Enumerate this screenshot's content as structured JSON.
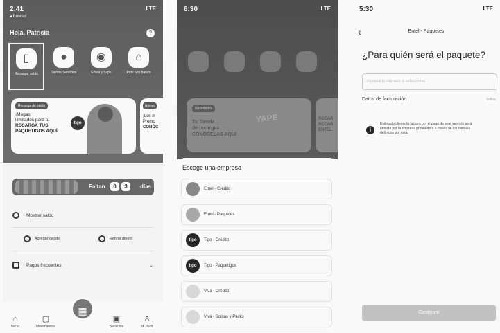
{
  "screen1": {
    "status": {
      "time": "2:41",
      "back_app": "◂ Buscar",
      "signal": "LTE"
    },
    "greeting": "Hola, Patricia",
    "quick_actions": [
      {
        "label": "Recargar saldo",
        "icon": "phone-card-icon"
      },
      {
        "label": "Tienda Servicios",
        "icon": "cart-icon"
      },
      {
        "label": "Envía y Yape",
        "icon": "send-icon"
      },
      {
        "label": "Pide a tu banco",
        "icon": "bank-icon"
      }
    ],
    "banner": {
      "tag": "Recarga de saldo",
      "line1": "¡Megas",
      "line2": "ilimitados para tu",
      "line3": "RECARGA TUS",
      "line4": "PAQUETIGOS AQUÍ",
      "logo": "tigo"
    },
    "banner2": {
      "tag": "Nuevo",
      "line1": "¡Los m",
      "line2": "Promo",
      "line3": "CONÓC"
    },
    "promo": {
      "label": "Faltan",
      "digit1": "0",
      "digit2": "3",
      "suffix": "días"
    },
    "rows": {
      "show_balance": "Mostrar saldo",
      "add_from": "Agregar desde",
      "withdraw": "Retirar dinero",
      "frequent_payments": "Pagos frecuentes"
    },
    "tabs": [
      {
        "label": "Inicio",
        "icon": "home-icon"
      },
      {
        "label": "Movimientos",
        "icon": "list-icon"
      },
      {
        "label": "Servicios",
        "icon": "services-icon"
      },
      {
        "label": "Mi Perfil",
        "icon": "user-icon"
      }
    ],
    "fab_icon": "qr-icon"
  },
  "screen2": {
    "status": {
      "time": "6:30",
      "signal": "LTE"
    },
    "banner": {
      "tag": "Novedades",
      "line1": "Tu Tienda",
      "line2": "de recargas",
      "line3": "CONÓCELAS AQUÍ",
      "yape": "YAPE"
    },
    "banner2": {
      "line1": "RECAR",
      "line2": "RECAR",
      "line3": "ENTEL"
    },
    "sheet_title": "Escoge una empresa",
    "companies": [
      {
        "name": "Entel - Crédito",
        "logo": "entel"
      },
      {
        "name": "Entel - Paquetes",
        "logo": "entel"
      },
      {
        "name": "Tigo - Crédito",
        "logo": "tigo"
      },
      {
        "name": "Tigo - Paquetigos",
        "logo": "tigo"
      },
      {
        "name": "Viva - Crédito",
        "logo": "viva"
      },
      {
        "name": "Viva - Bolsas y Packs",
        "logo": "viva"
      }
    ]
  },
  "screen3": {
    "status": {
      "time": "5:30",
      "signal": "LTE"
    },
    "header": "Entel - Paquetes",
    "question": "¿Para quién será el paquete?",
    "input_placeholder": "Ingresa tu número o selecciona",
    "billing_label": "Datos de facturación",
    "billing_edit": "Editar",
    "info_text": "Estimado cliente la factura por el pago de este servicio será emitida por la empresa proveedora a través de los canales definidos por ésta.",
    "cta": "Continuar"
  }
}
